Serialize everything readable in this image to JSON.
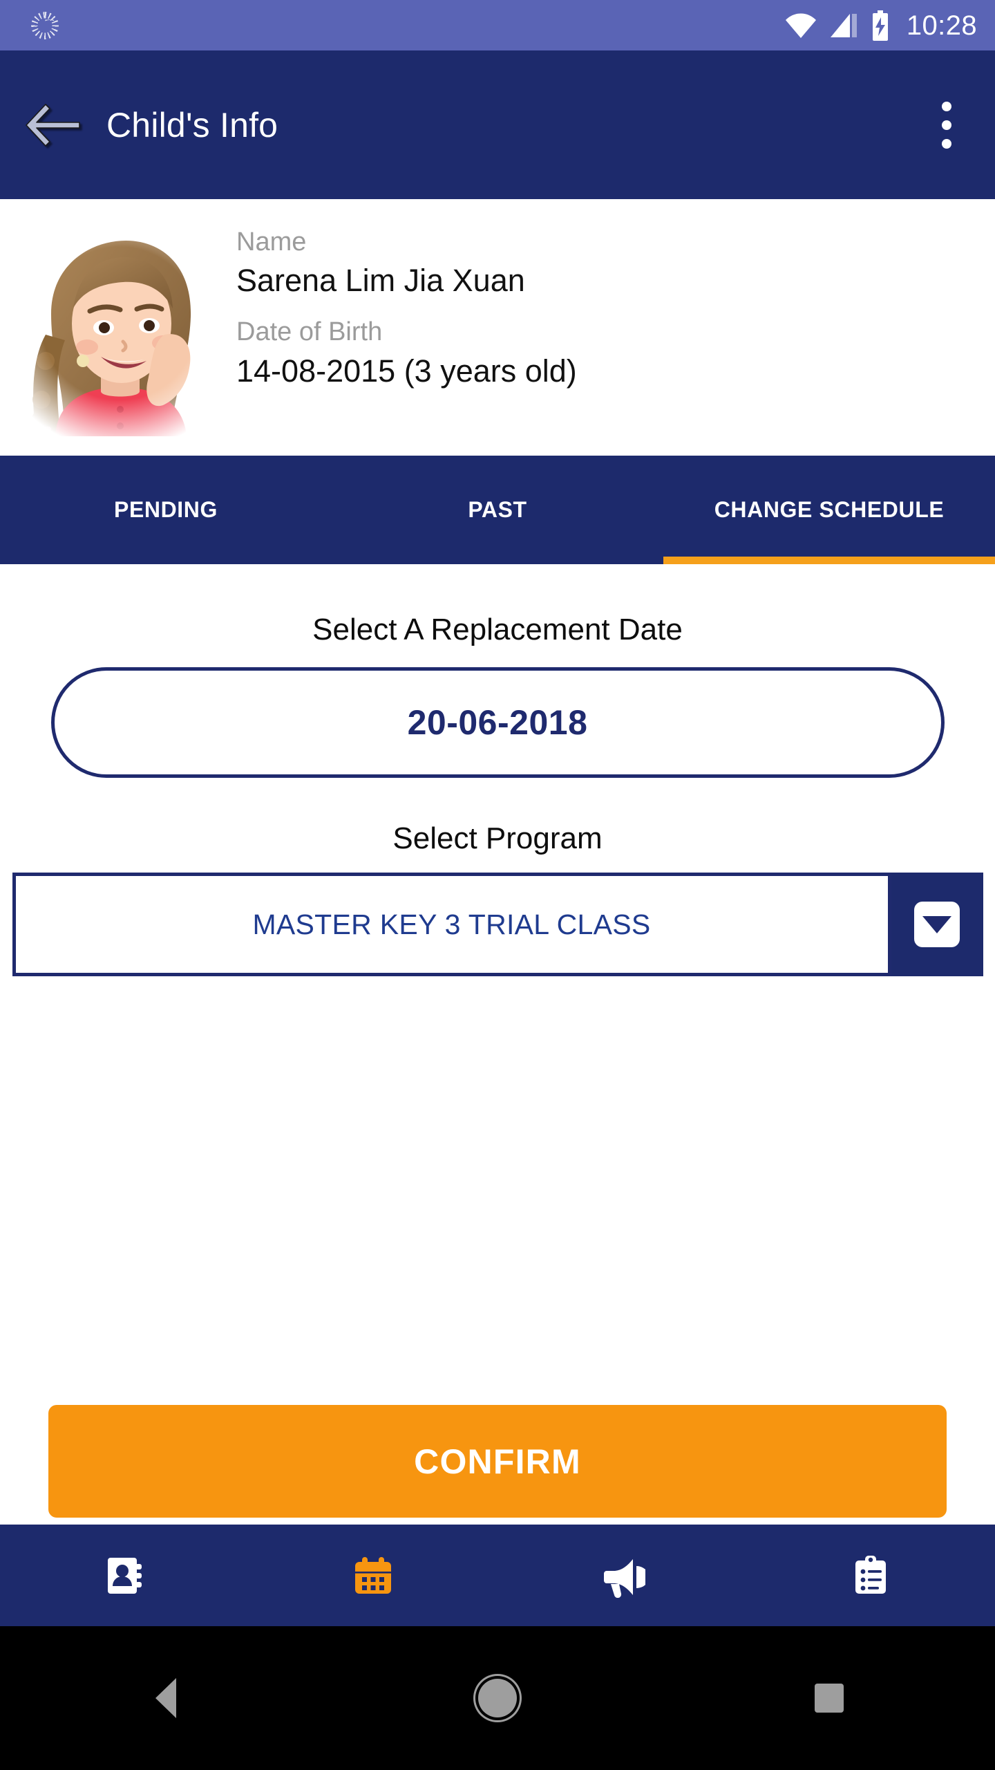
{
  "status_bar": {
    "sync_icon": "sync-spinner-icon",
    "wifi_icon": "wifi-icon",
    "signal_icon": "cellular-signal-icon",
    "battery_icon": "battery-charging-icon",
    "time": "10:28",
    "background_color": "#5a64b5"
  },
  "appbar": {
    "back_icon": "back-arrow-icon",
    "title": "Child's Info",
    "overflow_icon": "more-vertical-icon",
    "background_color": "#1d2a6c"
  },
  "child": {
    "avatar_icon": "child-photo-avatar",
    "name_label": "Name",
    "name_value": "Sarena Lim Jia Xuan",
    "dob_label": "Date of Birth",
    "dob_value": "14-08-2015 (3 years old)"
  },
  "tabs": {
    "items": [
      {
        "label": "PENDING",
        "active": false
      },
      {
        "label": "PAST",
        "active": false
      },
      {
        "label": "CHANGE SCHEDULE",
        "active": true
      }
    ],
    "indicator_color": "#f5a01b"
  },
  "form": {
    "date_heading": "Select A Replacement Date",
    "date_value": "20-06-2018",
    "program_heading": "Select Program",
    "program_value": "MASTER KEY 3 TRIAL CLASS",
    "dropdown_icon": "chevron-down-icon",
    "confirm_label": "CONFIRM",
    "confirm_color": "#f79510",
    "accent_navy": "#1f2a6e"
  },
  "bottom_nav": {
    "items": [
      {
        "icon": "contacts-book-icon",
        "active": false
      },
      {
        "icon": "calendar-icon",
        "active": true
      },
      {
        "icon": "megaphone-icon",
        "active": false
      },
      {
        "icon": "clipboard-list-icon",
        "active": false
      }
    ],
    "active_color": "#f79510",
    "inactive_color": "#ffffff"
  },
  "android_nav": {
    "back_icon": "android-back-icon",
    "home_icon": "android-home-icon",
    "recents_icon": "android-recents-icon"
  }
}
